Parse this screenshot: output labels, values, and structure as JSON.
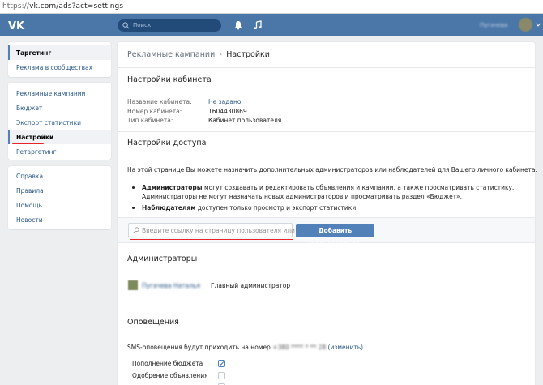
{
  "browser": {
    "url_scheme": "https://",
    "url_rest": "vk.com/ads?act=settings"
  },
  "topbar": {
    "search_placeholder": "Поиск",
    "user_name": "Пугачева",
    "brand_color": "#4a76a8"
  },
  "sidebar": {
    "group1": [
      {
        "label": "Таргетинг",
        "active": true
      },
      {
        "label": "Реклама в сообществах",
        "active": false
      }
    ],
    "group2": [
      {
        "label": "Рекламные кампании",
        "active": false
      },
      {
        "label": "Бюджет",
        "active": false
      },
      {
        "label": "Экспорт статистики",
        "active": false
      },
      {
        "label": "Настройки",
        "active": true
      },
      {
        "label": "Ретаргетинг",
        "active": false
      }
    ],
    "group3": [
      {
        "label": "Справка"
      },
      {
        "label": "Правила"
      },
      {
        "label": "Помощь"
      },
      {
        "label": "Новости"
      }
    ]
  },
  "breadcrumb": {
    "parent": "Рекламные кампании",
    "separator": "›",
    "current": "Настройки"
  },
  "cabinet": {
    "title": "Настройки кабинета",
    "rows": [
      {
        "label": "Название кабинета:",
        "value": "Не задано",
        "link": true
      },
      {
        "label": "Номер кабинета:",
        "value": "1604430869",
        "link": false
      },
      {
        "label": "Тип кабинета:",
        "value": "Кабинет пользователя",
        "link": false
      }
    ]
  },
  "access": {
    "title": "Настройки доступа",
    "intro": "На этой странице Вы можете назначить дополнительных администраторов или наблюдателей для Вашего личного кабинета:",
    "admins_bold": "Администраторы",
    "admins_line1": " могут создавать и редактировать объявления и кампании, а также просматривать статистику.",
    "admins_line2_bold": "Администраторы",
    "admins_line2": " не могут назначать новых администраторов и просматривать раздел «Бюджет».",
    "observers_bold": "Наблюдателям",
    "observers_text": " доступен только просмотр и экспорт статистики.",
    "input_placeholder": "Введите ссылку на страницу пользователя или адрес...",
    "add_button": "Добавить пользователя"
  },
  "administrators": {
    "title": "Администраторы",
    "items": [
      {
        "name": "Пугачева Наталья",
        "role": "Главный администратор"
      }
    ]
  },
  "notifications": {
    "title": "Оповещения",
    "sms_prefix": "SMS-оповещения будут приходить на номер ",
    "sms_number": "+380 **** * ** 28",
    "sms_change": "(изменить)",
    "sms_suffix": ".",
    "items": [
      {
        "label": "Пополнение бюджета",
        "checked": true
      },
      {
        "label": "Одобрение объявления",
        "checked": false
      },
      {
        "label": "",
        "checked": false
      }
    ]
  }
}
